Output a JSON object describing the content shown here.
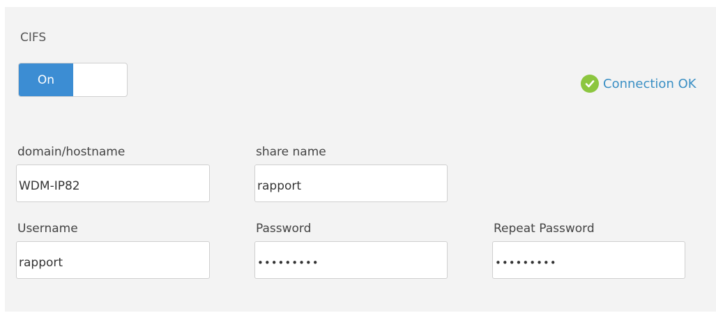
{
  "section": {
    "title": "CIFS"
  },
  "toggle": {
    "on_label": "On",
    "state": "on"
  },
  "status": {
    "text": "Connection OK",
    "icon": "check-circle-icon",
    "color": "#8cc63f"
  },
  "fields": {
    "domain": {
      "label": "domain/hostname",
      "value": "WDM-IP82"
    },
    "share": {
      "label": "share name",
      "value": "rapport"
    },
    "username": {
      "label": "Username",
      "value": "rapport"
    },
    "password": {
      "label": "Password",
      "value": "•••••••••"
    },
    "repeat_password": {
      "label": "Repeat Password",
      "value": "•••••••••"
    }
  },
  "colors": {
    "accent": "#3c8dd3",
    "panel_bg": "#f3f3f3",
    "link": "#3a8fc4"
  }
}
